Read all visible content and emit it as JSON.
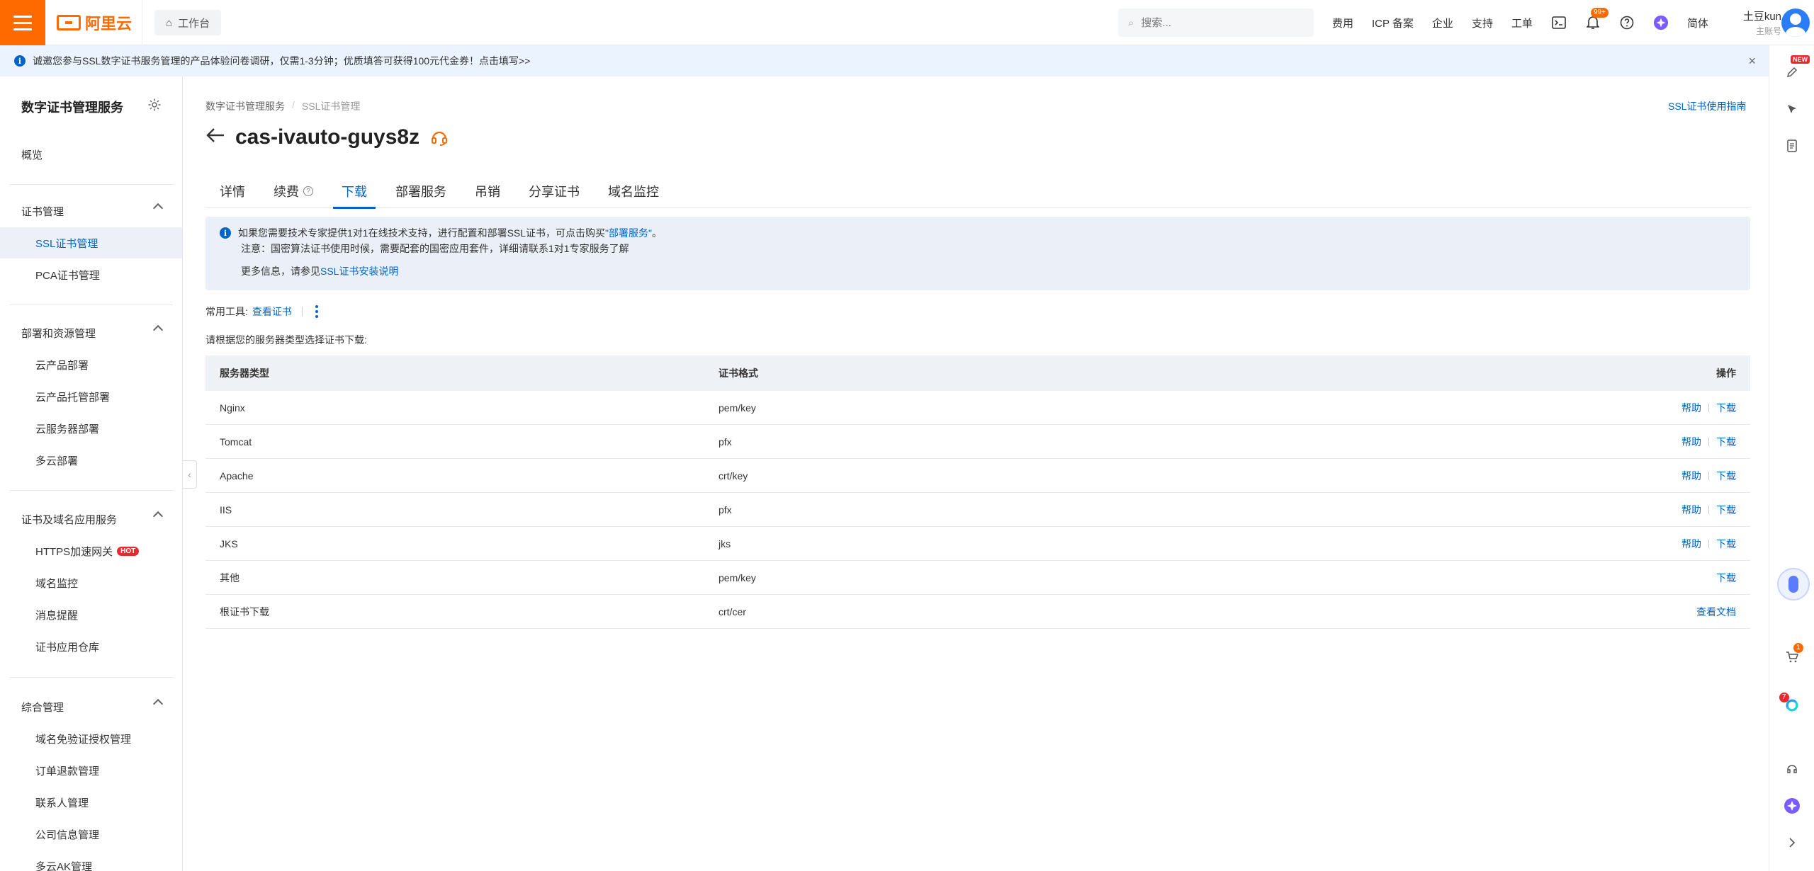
{
  "topbar": {
    "logo_text": "阿里云",
    "workbench_label": "工作台",
    "search_placeholder": "搜索...",
    "links": [
      "费用",
      "ICP 备案",
      "企业",
      "支持",
      "工单"
    ],
    "notification_count": "99+",
    "language": "简体",
    "user_name": "土豆kun",
    "user_role": "主账号"
  },
  "notice": {
    "text": "诚邀您参与SSL数字证书服务管理的产品体验问卷调研，仅需1-3分钟；优质填答可获得100元代金券！点击填写>>",
    "close": "×"
  },
  "right_rail": {
    "new_badge": "NEW",
    "cart_badge": "1",
    "assistant_badge": "7"
  },
  "sidebar": {
    "title": "数字证书管理服务",
    "overview": "概览",
    "groups": [
      {
        "label": "证书管理",
        "items": [
          "SSL证书管理",
          "PCA证书管理"
        ]
      },
      {
        "label": "部署和资源管理",
        "items": [
          "云产品部署",
          "云产品托管部署",
          "云服务器部署",
          "多云部署"
        ]
      },
      {
        "label": "证书及域名应用服务",
        "items": [
          "HTTPS加速网关",
          "域名监控",
          "消息提醒",
          "证书应用仓库"
        ]
      },
      {
        "label": "综合管理",
        "items": [
          "域名免验证授权管理",
          "订单退款管理",
          "联系人管理",
          "公司信息管理",
          "多云AK管理"
        ]
      }
    ],
    "hot_badge": "HOT"
  },
  "main": {
    "breadcrumb": [
      "数字证书管理服务",
      "/",
      "SSL证书管理"
    ],
    "guide_link": "SSL证书使用指南",
    "title": "cas-ivauto-guys8z",
    "tabs": [
      "详情",
      "续费",
      "下载",
      "部署服务",
      "吊销",
      "分享证书",
      "域名监控"
    ],
    "active_tab": "下载",
    "info": {
      "line1_prefix": "如果您需要技术专家提供1对1在线技术支持，进行配置和部署SSL证书，可点击购买",
      "line1_link": "\"部署服务\"",
      "line1_suffix": "。",
      "line2": "注意：国密算法证书使用时候，需要配套的国密应用套件，详细请联系1对1专家服务了解",
      "line3_prefix": "更多信息，请参见",
      "line3_link": "SSL证书安装说明"
    },
    "tools_label": "常用工具:",
    "tools_link": "查看证书",
    "hint": "请根据您的服务器类型选择证书下载:",
    "table": {
      "headers": [
        "服务器类型",
        "证书格式",
        "操作"
      ],
      "help_label": "帮助",
      "download_label": "下载",
      "rows": [
        {
          "server": "Nginx",
          "format": "pem/key",
          "ops": [
            "帮助",
            "下载"
          ]
        },
        {
          "server": "Tomcat",
          "format": "pfx",
          "ops": [
            "帮助",
            "下载"
          ]
        },
        {
          "server": "Apache",
          "format": "crt/key",
          "ops": [
            "帮助",
            "下载"
          ]
        },
        {
          "server": "IIS",
          "format": "pfx",
          "ops": [
            "帮助",
            "下载"
          ]
        },
        {
          "server": "JKS",
          "format": "jks",
          "ops": [
            "帮助",
            "下载"
          ]
        },
        {
          "server": "其他",
          "format": "pem/key",
          "ops": [
            "下载"
          ]
        },
        {
          "server": "根证书下载",
          "format": "crt/cer",
          "ops": [
            "查看文档"
          ]
        }
      ]
    }
  },
  "colors": {
    "brand": "#ff6a00",
    "link": "#0064c8",
    "notice_bg": "#eaf3fe",
    "hot": "#e8292e"
  }
}
